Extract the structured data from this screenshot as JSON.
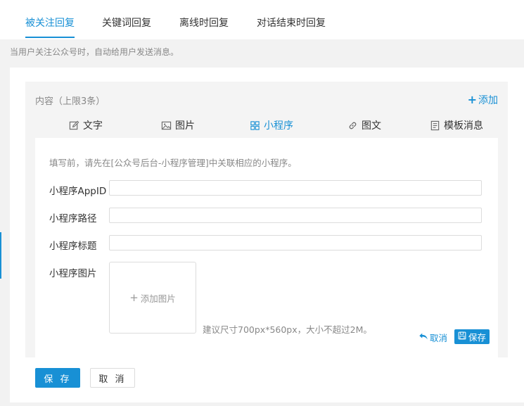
{
  "top_tabs": [
    {
      "label": "被关注回复",
      "active": true
    },
    {
      "label": "关键词回复",
      "active": false
    },
    {
      "label": "离线时回复",
      "active": false
    },
    {
      "label": "对话结束时回复",
      "active": false
    }
  ],
  "tip": "当用户关注公众号时，自动给用户发送消息。",
  "content": {
    "title": "内容（上限3条）",
    "add_label": "添加",
    "types": [
      {
        "label": "文字",
        "icon": "edit-icon",
        "active": false
      },
      {
        "label": "图片",
        "icon": "image-icon",
        "active": false
      },
      {
        "label": "小程序",
        "icon": "grid-icon",
        "active": true
      },
      {
        "label": "图文",
        "icon": "link-icon",
        "active": false
      },
      {
        "label": "模板消息",
        "icon": "template-icon",
        "active": false
      }
    ]
  },
  "form": {
    "hint": "填写前，请先在[公众号后台-小程序管理]中关联相应的小程序。",
    "appid_label": "小程序AppID",
    "appid_value": "",
    "path_label": "小程序路径",
    "path_value": "",
    "title_label": "小程序标题",
    "title_value": "",
    "image_label": "小程序图片",
    "upload_label": "添加图片",
    "size_hint": "建议尺寸700px*560px，大小不超过2M。",
    "cancel_label": "取消",
    "save_label": "保存"
  },
  "actions": {
    "save_label": "保 存",
    "cancel_label": "取 消"
  },
  "colors": {
    "accent": "#1890d5",
    "page_bg": "#f2f2f2",
    "panel_bg": "#f4f4f4"
  }
}
